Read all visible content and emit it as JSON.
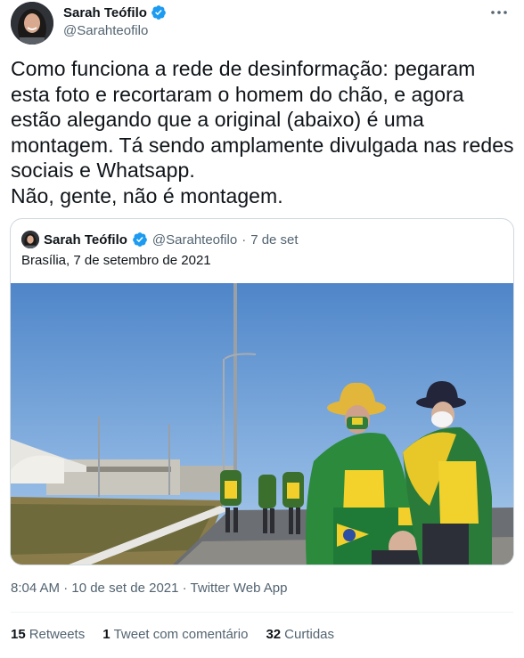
{
  "author": {
    "name": "Sarah Teófilo",
    "handle": "@Sarahteofilo"
  },
  "tweet": {
    "text": "Como funciona a rede de desinformação: pegaram\nesta foto e recortaram o homem do chão, e agora\nestão alegando que a original (abaixo) é uma\nmontagem. Tá sendo amplamente divulgada nas redes\nsociais e Whatsapp.\nNão, gente, não é montagem."
  },
  "quote": {
    "name": "Sarah Teófilo",
    "handle": "@Sarahteofilo",
    "separator": "·",
    "date": "7 de set",
    "text": "Brasília, 7 de setembro de 2021"
  },
  "meta": {
    "timestamp": "8:04 AM · 10 de set de 2021 · Twitter Web App"
  },
  "stats": [
    {
      "count": "15",
      "label": "Retweets"
    },
    {
      "count": "1",
      "label": "Tweet com comentário"
    },
    {
      "count": "32",
      "label": "Curtidas"
    }
  ],
  "colors": {
    "verified": "#1d9bf0",
    "secondary_text": "#536471",
    "border": "#cfd9de"
  }
}
